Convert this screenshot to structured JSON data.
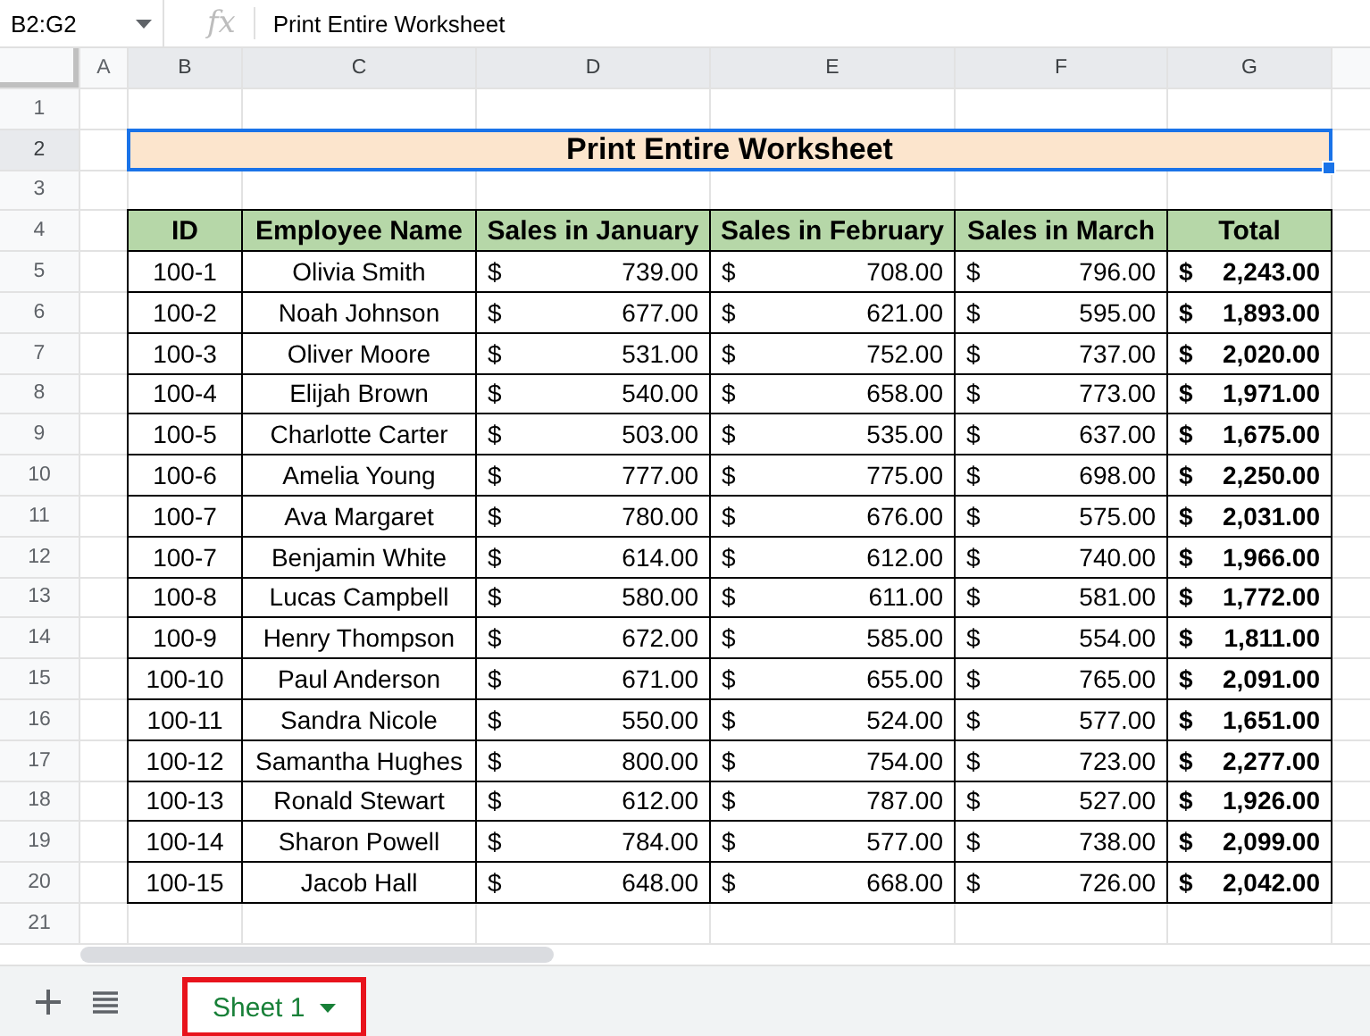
{
  "formula_bar": {
    "name_box": "B2:G2",
    "fx": "fx",
    "formula": "Print Entire Worksheet"
  },
  "columns": [
    {
      "label": "A",
      "selected": false
    },
    {
      "label": "B",
      "selected": true
    },
    {
      "label": "C",
      "selected": true
    },
    {
      "label": "D",
      "selected": true
    },
    {
      "label": "E",
      "selected": true
    },
    {
      "label": "F",
      "selected": true
    },
    {
      "label": "G",
      "selected": true
    }
  ],
  "row_numbers": [
    {
      "label": "1",
      "selected": false
    },
    {
      "label": "2",
      "selected": true
    },
    {
      "label": "3",
      "selected": false
    },
    {
      "label": "4",
      "selected": false
    },
    {
      "label": "5",
      "selected": false
    },
    {
      "label": "6",
      "selected": false
    },
    {
      "label": "7",
      "selected": false
    },
    {
      "label": "8",
      "selected": false
    },
    {
      "label": "9",
      "selected": false
    },
    {
      "label": "10",
      "selected": false
    },
    {
      "label": "11",
      "selected": false
    },
    {
      "label": "12",
      "selected": false
    },
    {
      "label": "13",
      "selected": false
    },
    {
      "label": "14",
      "selected": false
    },
    {
      "label": "15",
      "selected": false
    },
    {
      "label": "16",
      "selected": false
    },
    {
      "label": "17",
      "selected": false
    },
    {
      "label": "18",
      "selected": false
    },
    {
      "label": "19",
      "selected": false
    },
    {
      "label": "20",
      "selected": false
    },
    {
      "label": "21",
      "selected": false
    }
  ],
  "title": "Print Entire Worksheet",
  "table": {
    "columns": [
      "ID",
      "Employee Name",
      "Sales in January",
      "Sales in February",
      "Sales in March",
      "Total"
    ],
    "rows": [
      {
        "id": "100-1",
        "name": "Olivia Smith",
        "jan": {
          "currency": "$",
          "amount": "739.00"
        },
        "feb": {
          "currency": "$",
          "amount": "708.00"
        },
        "mar": {
          "currency": "$",
          "amount": "796.00"
        },
        "total": {
          "currency": "$",
          "amount": "2,243.00"
        }
      },
      {
        "id": "100-2",
        "name": "Noah Johnson",
        "jan": {
          "currency": "$",
          "amount": "677.00"
        },
        "feb": {
          "currency": "$",
          "amount": "621.00"
        },
        "mar": {
          "currency": "$",
          "amount": "595.00"
        },
        "total": {
          "currency": "$",
          "amount": "1,893.00"
        }
      },
      {
        "id": "100-3",
        "name": "Oliver Moore",
        "jan": {
          "currency": "$",
          "amount": "531.00"
        },
        "feb": {
          "currency": "$",
          "amount": "752.00"
        },
        "mar": {
          "currency": "$",
          "amount": "737.00"
        },
        "total": {
          "currency": "$",
          "amount": "2,020.00"
        }
      },
      {
        "id": "100-4",
        "name": "Elijah Brown",
        "jan": {
          "currency": "$",
          "amount": "540.00"
        },
        "feb": {
          "currency": "$",
          "amount": "658.00"
        },
        "mar": {
          "currency": "$",
          "amount": "773.00"
        },
        "total": {
          "currency": "$",
          "amount": "1,971.00"
        }
      },
      {
        "id": "100-5",
        "name": "Charlotte Carter",
        "jan": {
          "currency": "$",
          "amount": "503.00"
        },
        "feb": {
          "currency": "$",
          "amount": "535.00"
        },
        "mar": {
          "currency": "$",
          "amount": "637.00"
        },
        "total": {
          "currency": "$",
          "amount": "1,675.00"
        }
      },
      {
        "id": "100-6",
        "name": "Amelia Young",
        "jan": {
          "currency": "$",
          "amount": "777.00"
        },
        "feb": {
          "currency": "$",
          "amount": "775.00"
        },
        "mar": {
          "currency": "$",
          "amount": "698.00"
        },
        "total": {
          "currency": "$",
          "amount": "2,250.00"
        }
      },
      {
        "id": "100-7",
        "name": "Ava Margaret",
        "jan": {
          "currency": "$",
          "amount": "780.00"
        },
        "feb": {
          "currency": "$",
          "amount": "676.00"
        },
        "mar": {
          "currency": "$",
          "amount": "575.00"
        },
        "total": {
          "currency": "$",
          "amount": "2,031.00"
        }
      },
      {
        "id": "100-7",
        "name": "Benjamin White",
        "jan": {
          "currency": "$",
          "amount": "614.00"
        },
        "feb": {
          "currency": "$",
          "amount": "612.00"
        },
        "mar": {
          "currency": "$",
          "amount": "740.00"
        },
        "total": {
          "currency": "$",
          "amount": "1,966.00"
        }
      },
      {
        "id": "100-8",
        "name": "Lucas Campbell",
        "jan": {
          "currency": "$",
          "amount": "580.00"
        },
        "feb": {
          "currency": "$",
          "amount": "611.00"
        },
        "mar": {
          "currency": "$",
          "amount": "581.00"
        },
        "total": {
          "currency": "$",
          "amount": "1,772.00"
        }
      },
      {
        "id": "100-9",
        "name": "Henry Thompson",
        "jan": {
          "currency": "$",
          "amount": "672.00"
        },
        "feb": {
          "currency": "$",
          "amount": "585.00"
        },
        "mar": {
          "currency": "$",
          "amount": "554.00"
        },
        "total": {
          "currency": "$",
          "amount": "1,811.00"
        }
      },
      {
        "id": "100-10",
        "name": "Paul Anderson",
        "jan": {
          "currency": "$",
          "amount": "671.00"
        },
        "feb": {
          "currency": "$",
          "amount": "655.00"
        },
        "mar": {
          "currency": "$",
          "amount": "765.00"
        },
        "total": {
          "currency": "$",
          "amount": "2,091.00"
        }
      },
      {
        "id": "100-11",
        "name": "Sandra Nicole",
        "jan": {
          "currency": "$",
          "amount": "550.00"
        },
        "feb": {
          "currency": "$",
          "amount": "524.00"
        },
        "mar": {
          "currency": "$",
          "amount": "577.00"
        },
        "total": {
          "currency": "$",
          "amount": "1,651.00"
        }
      },
      {
        "id": "100-12",
        "name": "Samantha Hughes",
        "jan": {
          "currency": "$",
          "amount": "800.00"
        },
        "feb": {
          "currency": "$",
          "amount": "754.00"
        },
        "mar": {
          "currency": "$",
          "amount": "723.00"
        },
        "total": {
          "currency": "$",
          "amount": "2,277.00"
        }
      },
      {
        "id": "100-13",
        "name": "Ronald Stewart",
        "jan": {
          "currency": "$",
          "amount": "612.00"
        },
        "feb": {
          "currency": "$",
          "amount": "787.00"
        },
        "mar": {
          "currency": "$",
          "amount": "527.00"
        },
        "total": {
          "currency": "$",
          "amount": "1,926.00"
        }
      },
      {
        "id": "100-14",
        "name": "Sharon Powell",
        "jan": {
          "currency": "$",
          "amount": "784.00"
        },
        "feb": {
          "currency": "$",
          "amount": "577.00"
        },
        "mar": {
          "currency": "$",
          "amount": "738.00"
        },
        "total": {
          "currency": "$",
          "amount": "2,099.00"
        }
      },
      {
        "id": "100-15",
        "name": "Jacob Hall",
        "jan": {
          "currency": "$",
          "amount": "648.00"
        },
        "feb": {
          "currency": "$",
          "amount": "668.00"
        },
        "mar": {
          "currency": "$",
          "amount": "726.00"
        },
        "total": {
          "currency": "$",
          "amount": "2,042.00"
        }
      }
    ]
  },
  "sheet_tabs": [
    {
      "label": "Sheet 1",
      "selected": true,
      "highlighted": true
    }
  ]
}
